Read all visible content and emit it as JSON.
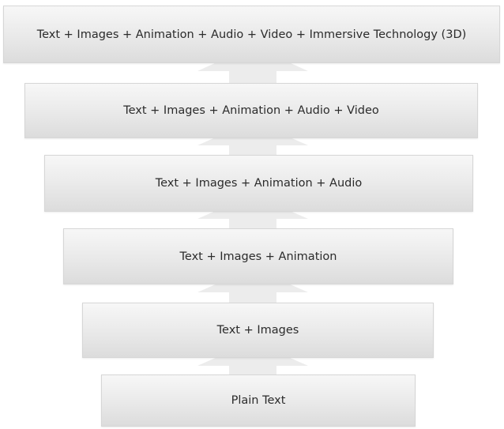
{
  "diagram": {
    "tiers": [
      {
        "label": "Text + Images + Animation + Audio + Video + Immersive Technology (3D)"
      },
      {
        "label": "Text + Images + Animation + Audio + Video"
      },
      {
        "label": "Text + Images + Animation + Audio"
      },
      {
        "label": "Text + Images + Animation"
      },
      {
        "label": "Text + Images"
      },
      {
        "label": "Plain Text"
      }
    ]
  },
  "colors": {
    "box_top": "#f7f7f7",
    "box_bottom": "#dcdcdc",
    "arrow": "#ececec",
    "text": "#2b2b2b"
  }
}
